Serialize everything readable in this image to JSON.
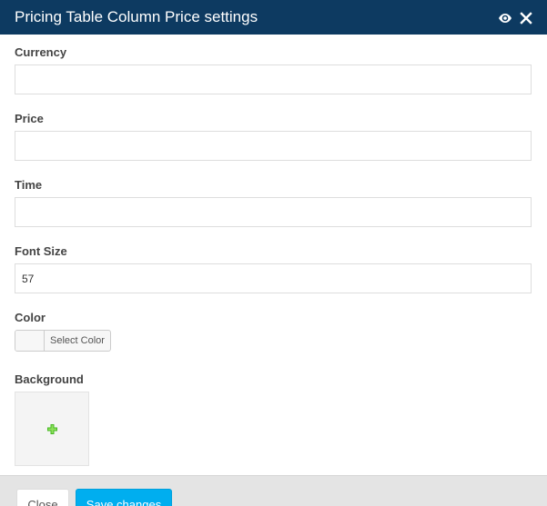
{
  "dialog": {
    "title": "Pricing Table Column Price settings",
    "icons": [
      "eye-icon",
      "close-icon"
    ]
  },
  "fields": {
    "currency": {
      "label": "Currency",
      "value": ""
    },
    "price": {
      "label": "Price",
      "value": ""
    },
    "time": {
      "label": "Time",
      "value": ""
    },
    "font_size": {
      "label": "Font Size",
      "value": "57"
    }
  },
  "color": {
    "label": "Color",
    "button_label": "Select Color"
  },
  "background": {
    "label": "Background",
    "add_icon": "plus-icon"
  },
  "footer": {
    "close_label": "Close",
    "save_label": "Save changes"
  },
  "colors": {
    "titlebar": "#0d3a61",
    "primary_button": "#00aeef",
    "plus": "#44b821"
  }
}
